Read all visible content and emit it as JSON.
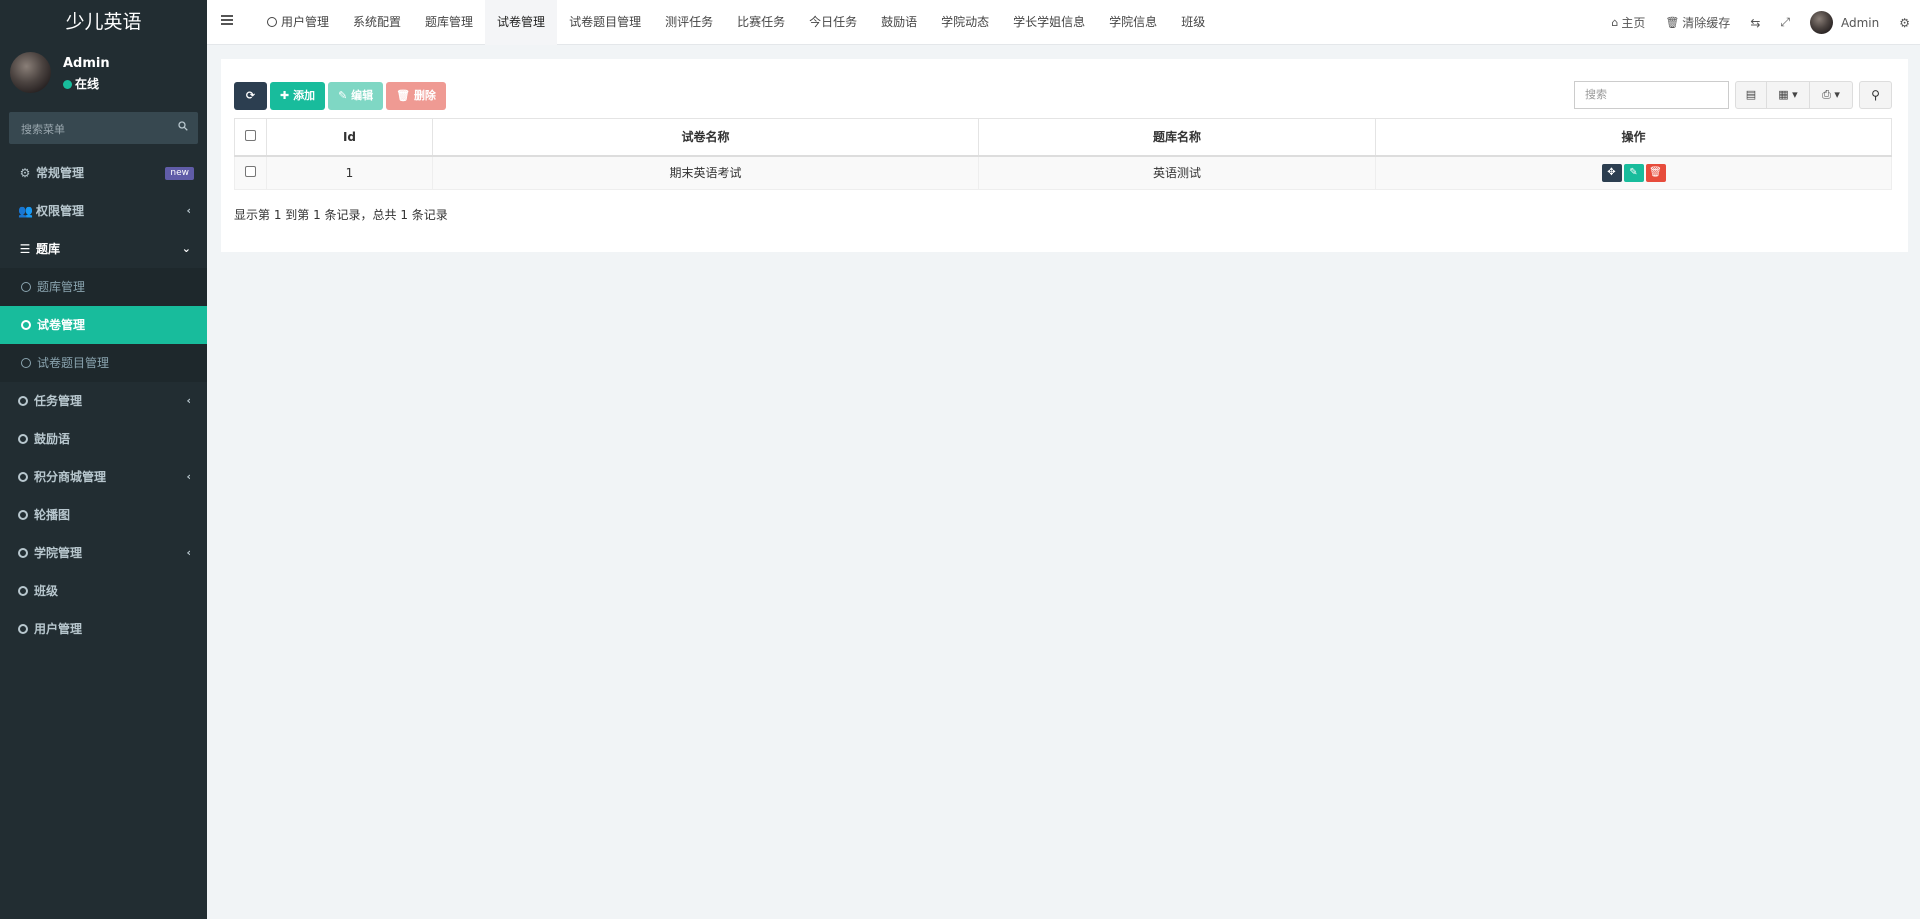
{
  "app": {
    "brand": "少儿英语",
    "user_name": "Admin",
    "user_status": "在线",
    "search_placeholder": "搜索菜单"
  },
  "sidebar": {
    "items": [
      {
        "label": "常规管理",
        "badge": "new"
      },
      {
        "label": "权限管理"
      },
      {
        "label": "题库"
      },
      {
        "label": "题库管理"
      },
      {
        "label": "试卷管理"
      },
      {
        "label": "试卷题目管理"
      },
      {
        "label": "任务管理"
      },
      {
        "label": "鼓励语"
      },
      {
        "label": "积分商城管理"
      },
      {
        "label": "轮播图"
      },
      {
        "label": "学院管理"
      },
      {
        "label": "班级"
      },
      {
        "label": "用户管理"
      }
    ]
  },
  "navbar": {
    "tabs": [
      "用户管理",
      "系统配置",
      "题库管理",
      "试卷管理",
      "试卷题目管理",
      "测评任务",
      "比赛任务",
      "今日任务",
      "鼓励语",
      "学院动态",
      "学长学姐信息",
      "学院信息",
      "班级"
    ],
    "home": "主页",
    "clear_cache": "清除缓存",
    "user": "Admin"
  },
  "toolbar": {
    "add": "添加",
    "edit": "编辑",
    "delete": "删除",
    "search_placeholder": "搜索"
  },
  "table": {
    "headers": [
      "Id",
      "试卷名称",
      "题库名称",
      "操作"
    ],
    "rows": [
      {
        "id": "1",
        "paper_name": "期末英语考试",
        "bank_name": "英语测试"
      }
    ],
    "pagination_info": "显示第 1 到第 1 条记录，总共 1 条记录"
  },
  "colors": {
    "sidebar_bg": "#222d32",
    "accent": "#18bc9c",
    "dark_button": "#2c3e50",
    "danger": "#e74c3c",
    "badge": "#605ca8"
  }
}
